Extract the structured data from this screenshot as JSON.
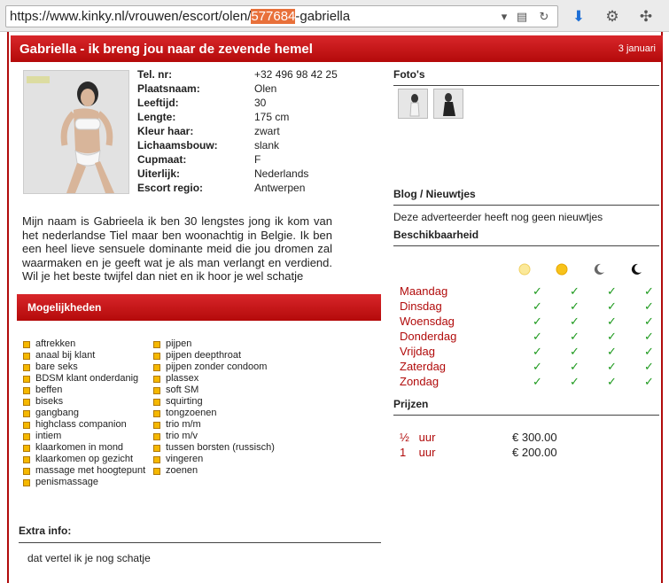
{
  "browser": {
    "url_prefix": "https://www.kinky.nl/vrouwen/escort/olen/",
    "url_highlight": "577684",
    "url_suffix": "-gabriella"
  },
  "header": {
    "title": "Gabriella - ik breng jou naar de zevende hemel",
    "date": "3 januari"
  },
  "details": [
    {
      "label": "Tel. nr:",
      "value": "+32 496 98 42 25"
    },
    {
      "label": "Plaatsnaam:",
      "value": "Olen"
    },
    {
      "label": "Leeftijd:",
      "value": "30"
    },
    {
      "label": "Lengte:",
      "value": "175 cm"
    },
    {
      "label": "Kleur haar:",
      "value": "zwart"
    },
    {
      "label": "Lichaamsbouw:",
      "value": "slank"
    },
    {
      "label": "Cupmaat:",
      "value": "F"
    },
    {
      "label": "Uiterlijk:",
      "value": "Nederlands"
    },
    {
      "label": "Escort regio:",
      "value": "Antwerpen"
    }
  ],
  "bio": "Mijn naam is Gabrieela ik ben 30 lengstes jong ik kom van het nederlandse Tiel maar ben woonachtig in Belgie. Ik ben een heel lieve sensuele dominante meid die jou dromen zal waarmaken en je geeft wat je als man verlangt en verdiend. Wil je het beste twijfel dan niet en ik hoor je wel schatje",
  "options": {
    "heading": "Mogelijkheden",
    "left": [
      "aftrekken",
      "anaal bij klant",
      "bare seks",
      "BDSM klant onderdanig",
      "beffen",
      "biseks",
      "gangbang",
      "highclass companion",
      "intiem",
      "klaarkomen in mond",
      "klaarkomen op gezicht",
      "massage met hoogtepunt",
      "penismassage"
    ],
    "right": [
      "pijpen",
      "pijpen deepthroat",
      "pijpen zonder condoom",
      "plassex",
      "soft SM",
      "squirting",
      "tongzoenen",
      "trio m/m",
      "trio m/v",
      "tussen borsten (russisch)",
      "vingeren",
      "zoenen"
    ]
  },
  "extra": {
    "heading": "Extra info:",
    "text": "dat vertel ik je nog schatje"
  },
  "photos": {
    "heading": "Foto's",
    "count": 2
  },
  "blog": {
    "heading": "Blog / Nieuwtjes",
    "text": "Deze adverteerder heeft nog geen nieuwtjes"
  },
  "availability": {
    "heading": "Beschikbaarheid",
    "icons": [
      "morning-sun-icon",
      "afternoon-sun-icon",
      "evening-moon-icon",
      "night-moon-icon"
    ],
    "days": [
      "Maandag",
      "Dinsdag",
      "Woensdag",
      "Donderdag",
      "Vrijdag",
      "Zaterdag",
      "Zondag"
    ],
    "check": "✓"
  },
  "prices": {
    "heading": "Prijzen",
    "rows": [
      {
        "label": "½   uur",
        "value": "€ 300.00"
      },
      {
        "label": "1    uur",
        "value": "€ 200.00"
      }
    ]
  },
  "colors": {
    "brand_red": "#b10b0b",
    "check_green": "#1e9a1e",
    "bullet_orange": "#f5b800"
  }
}
